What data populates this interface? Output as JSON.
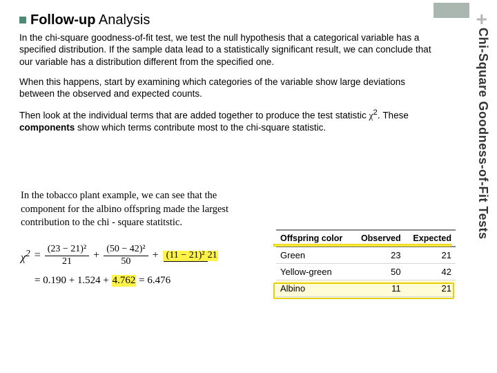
{
  "corner": {
    "plus": "+"
  },
  "sideTitle": "Chi-Square Goodness-of-Fit Tests",
  "heading": {
    "bold": "Follow-up",
    "rest": " Analysis"
  },
  "para1": "In the chi-square goodness-of-fit test, we test the null hypothesis that a categorical variable has a specified distribution. If the sample data lead to a statistically significant result, we can conclude that our variable has a distribution different from the specified one.",
  "para2": "When this happens, start by examining which categories of the variable show large deviations between the observed and expected counts.",
  "para3_a": "Then look at the individual terms that are added together to produce the test statistic ",
  "para3_chi": "χ",
  "para3_sup": "2",
  "para3_b": ". These ",
  "para3_bold": "components",
  "para3_c": " show which terms contribute most to the chi-square statistic.",
  "tobacco": "In the tobacco plant example, we can see that the component for the albino offspring made the largest contribution to the chi - square statitstic.",
  "formula": {
    "chi": "χ",
    "sup": "2",
    "eq": "=",
    "plus": "+",
    "f1n": "(23 − 21)²",
    "f1d": "21",
    "f2n": "(50 − 42)²",
    "f2d": "50",
    "f3n": "(11 − 21)²",
    "f3d": "21",
    "row2_a": "= 0.190 + 1.524 + ",
    "row2_hl": "4.762",
    "row2_b": " = 6.476"
  },
  "table": {
    "headers": [
      "Offspring color",
      "Observed",
      "Expected"
    ],
    "rows": [
      {
        "color": "Green",
        "obs": "23",
        "exp": "21"
      },
      {
        "color": "Yellow-green",
        "obs": "50",
        "exp": "42"
      },
      {
        "color": "Albino",
        "obs": "11",
        "exp": "21"
      }
    ]
  }
}
